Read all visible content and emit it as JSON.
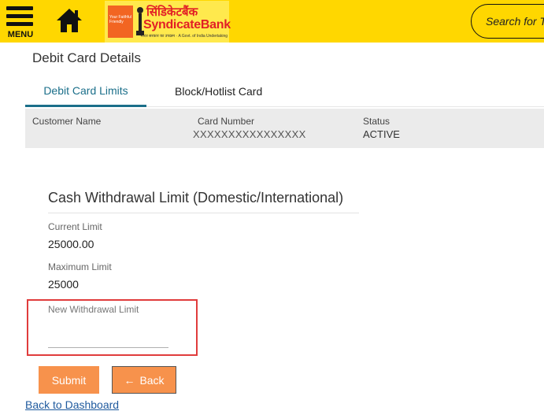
{
  "header": {
    "menu_label": "MENU",
    "search_placeholder": "Search for T",
    "logo": {
      "hindi_name": "सिंडिकेटबैंक",
      "english_name": "SyndicateBank",
      "tagline": "भारत सरकार का उपक्रम · A Govt. of India Undertaking",
      "box_text": "Your Faithful Friendly"
    }
  },
  "page": {
    "title": "Debit Card Details",
    "tabs": [
      {
        "label": "Debit Card Limits",
        "active": true
      },
      {
        "label": "Block/Hotlist Card",
        "active": false
      }
    ],
    "info": {
      "customer_name_label": "Customer Name",
      "customer_name_value": "",
      "card_number_label": "Card Number",
      "card_number_value": "XXXXXXXXXXXXXXXX",
      "status_label": "Status",
      "status_value": "ACTIVE"
    },
    "section_title": "Cash Withdrawal Limit (Domestic/International)",
    "current_limit_label": "Current Limit",
    "current_limit_value": "25000.00",
    "maximum_limit_label": "Maximum Limit",
    "maximum_limit_value": "25000",
    "new_limit_label": "New Withdrawal Limit",
    "new_limit_value": "",
    "submit_label": "Submit",
    "back_label": "Back",
    "back_arrow": "←",
    "dashboard_link": "Back to Dashboard"
  },
  "colors": {
    "header_bg": "#ffd700",
    "active_tab": "#1b6f8a",
    "button": "#f7924c",
    "highlight_border": "#e03c3c",
    "link": "#1f5a9e"
  }
}
